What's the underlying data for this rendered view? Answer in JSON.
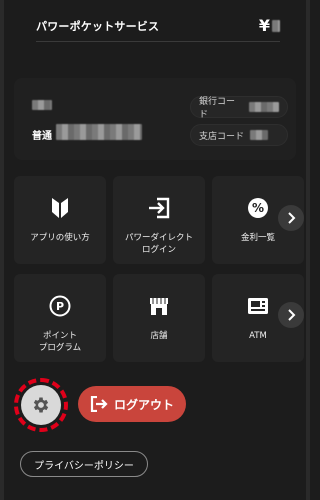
{
  "header": {
    "title": "パワーポケットサービス",
    "currency_symbol": "¥"
  },
  "account": {
    "type_label": "普通",
    "bank_code_label": "銀行コード",
    "branch_code_label": "支店コード"
  },
  "tiles": [
    {
      "label": "アプリの使い方",
      "icon": "shield-icon"
    },
    {
      "label": "パワーダイレクト\nログイン",
      "icon": "login-arrow-icon"
    },
    {
      "label": "金利一覧",
      "icon": "percent-icon"
    },
    {
      "label": "ポイント\nプログラム",
      "icon": "point-p-icon"
    },
    {
      "label": "店舗",
      "icon": "store-icon"
    },
    {
      "label": "ATM",
      "icon": "atm-icon"
    }
  ],
  "actions": {
    "logout_label": "ログアウト",
    "privacy_label": "プライバシーポリシー"
  },
  "colors": {
    "background": "#1c1c1c",
    "tile": "#242424",
    "logout": "#c9453c",
    "highlight_ring": "#e0001a"
  }
}
